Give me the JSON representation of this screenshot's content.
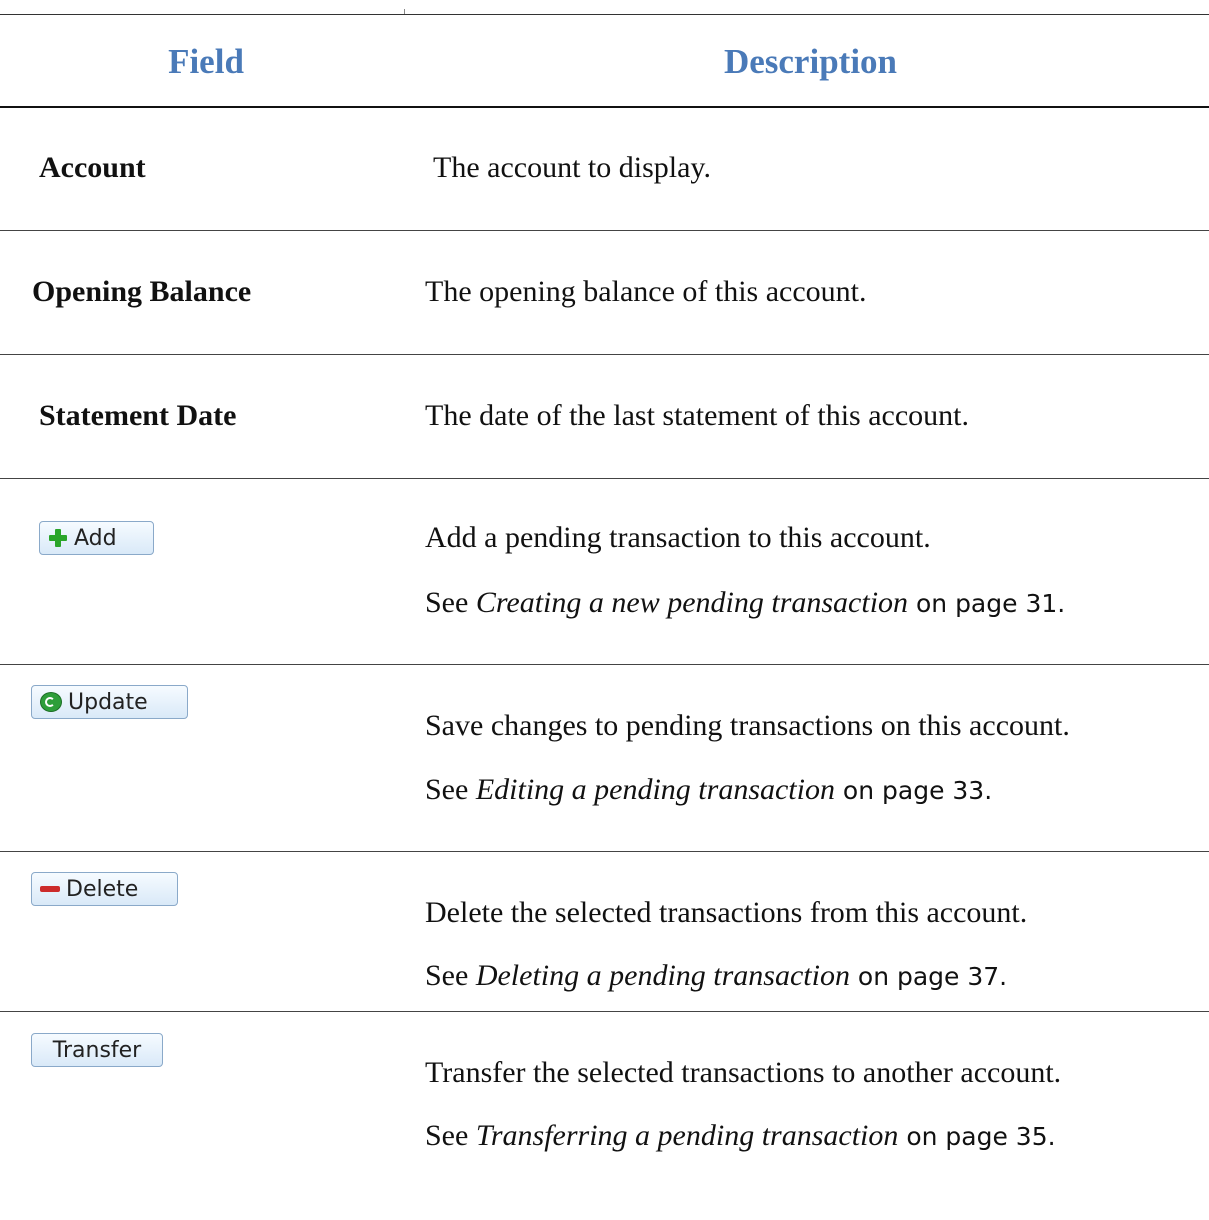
{
  "table": {
    "headers": {
      "field": "Field",
      "description": "Description"
    },
    "rows": [
      {
        "field": "Account",
        "description": "The account to display."
      },
      {
        "field": "Opening Balance",
        "description": "The opening balance of this account."
      },
      {
        "field": "Statement Date",
        "description": "The date of the last statement of this account."
      },
      {
        "button": {
          "label": "Add",
          "icon": "plus-icon"
        },
        "description": "Add a pending transaction to this account.",
        "see": {
          "prefix": "See ",
          "link": "Creating a new pending transaction",
          "suffix": " on page 31."
        }
      },
      {
        "button": {
          "label": "Update",
          "icon": "refresh-icon"
        },
        "description": "Save changes to pending transactions on this account.",
        "see": {
          "prefix": "See ",
          "link": "Editing a pending transaction",
          "suffix": " on page 33."
        }
      },
      {
        "button": {
          "label": "Delete",
          "icon": "minus-icon"
        },
        "description": "Delete the selected transactions from this account.",
        "see": {
          "prefix": "See ",
          "link": "Deleting a pending transaction",
          "suffix": " on page 37."
        }
      },
      {
        "button": {
          "label": "Transfer"
        },
        "description": "Transfer the selected transactions to another account.",
        "see": {
          "prefix": "See ",
          "link": "Transferring a pending transaction",
          "suffix": " on page 35."
        }
      }
    ]
  },
  "colors": {
    "header_text": "#4a7ab8",
    "button_border": "#8aa9c9",
    "button_fill": "#d9e9f8"
  }
}
